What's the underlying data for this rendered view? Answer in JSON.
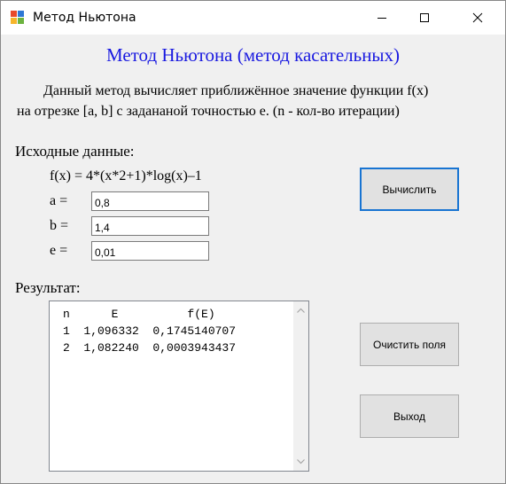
{
  "window": {
    "title": "Метод Ньютона"
  },
  "heading": "Метод Ньютона (метод касательных)",
  "description": {
    "line1": "Данный метод вычисляет приближённое значение функции f(x)",
    "line2": "на отрезке [a, b] с задананой точностью e. (n - кол-во итерации)"
  },
  "input_section": {
    "title": "Исходные данные:",
    "formula": "f(x) = 4*(x*2+1)*log(x)–1",
    "a_label": "a =",
    "a_value": "0,8",
    "b_label": "b =",
    "b_value": "1,4",
    "e_label": "e =",
    "e_value": "0,01"
  },
  "result_section": {
    "title": "Результат:",
    "header": "n      E          f(E)",
    "rows": [
      "1  1,096332  0,1745140707",
      "2  1,082240  0,0003943437"
    ]
  },
  "buttons": {
    "compute": "Вычислить",
    "clear": "Очистить поля",
    "exit": "Выход"
  },
  "colors": {
    "heading": "#1a1ae0",
    "default_button_border": "#1874d2",
    "window_bg": "#f0f0f0"
  }
}
